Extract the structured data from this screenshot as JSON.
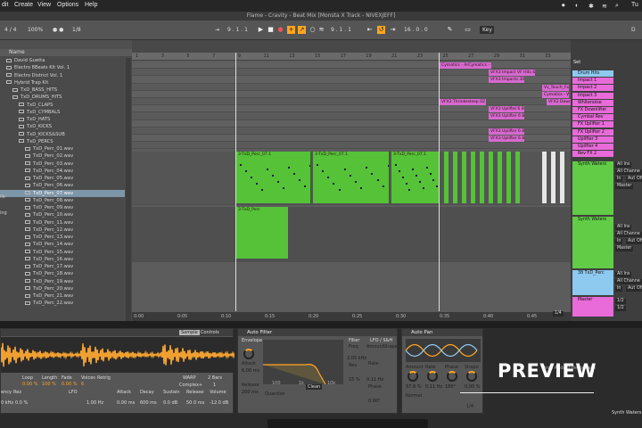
{
  "menubar": {
    "items": [
      "dit",
      "Create",
      "View",
      "Options",
      "Help"
    ],
    "right_text": "Tu"
  },
  "window_title": "Flame - Cravity - Beat Mix  [Monsta X Track - NIVEXJEFF]",
  "transport": {
    "time_sig": "4 / 4",
    "zoom": "100%",
    "quant": "1 Bar",
    "grid": "1/8",
    "position": "9 .  1 .  1",
    "loop_start": "9 .  1 .  1",
    "loop_len": "16 .  0 .  0",
    "link_label": "Link",
    "tap_label": "Tap",
    "tempo": "130.00",
    "right_readout": "D",
    "cpu_label": "Key"
  },
  "browser": {
    "header": "Name",
    "items": [
      {
        "label": "David Guetta",
        "indent": 1
      },
      {
        "label": "Electro 8Beats Kit Vol. 1",
        "indent": 1
      },
      {
        "label": "Electro District Vol. 1",
        "indent": 1
      },
      {
        "label": "Hybrid Trap Kit",
        "indent": 1
      },
      {
        "label": "TxD_BASS_HITS",
        "indent": 2
      },
      {
        "label": "TxD_DRUMS_HITS",
        "indent": 2
      },
      {
        "label": "TxD_CLAPS",
        "indent": 3
      },
      {
        "label": "TxD_CYMBALS",
        "indent": 3
      },
      {
        "label": "TxD_HATS",
        "indent": 3
      },
      {
        "label": "TxD_KICKS",
        "indent": 3
      },
      {
        "label": "TxD_KICKS&SUB",
        "indent": 3
      },
      {
        "label": "TxD_PERCS",
        "indent": 3
      },
      {
        "label": "TxD_Perc_01.wav",
        "indent": 4
      },
      {
        "label": "TxD_Perc_02.wav",
        "indent": 4
      },
      {
        "label": "TxD_Perc_03.wav",
        "indent": 4
      },
      {
        "label": "TxD_Perc_04.wav",
        "indent": 4
      },
      {
        "label": "TxD_Perc_05.wav",
        "indent": 4
      },
      {
        "label": "TxD_Perc_06.wav",
        "indent": 4
      },
      {
        "label": "TxD_Perc_07.wav",
        "indent": 4,
        "selected": true
      },
      {
        "label": "TxD_Perc_08.wav",
        "indent": 4
      },
      {
        "label": "TxD_Perc_09.wav",
        "indent": 4
      },
      {
        "label": "TxD_Perc_10.wav",
        "indent": 4
      },
      {
        "label": "TxD_Perc_11.wav",
        "indent": 4
      },
      {
        "label": "TxD_Perc_12.wav",
        "indent": 4
      },
      {
        "label": "TxD_Perc_13.wav",
        "indent": 4
      },
      {
        "label": "TxD_Perc_14.wav",
        "indent": 4
      },
      {
        "label": "TxD_Perc_15.wav",
        "indent": 4
      },
      {
        "label": "TxD_Perc_16.wav",
        "indent": 4
      },
      {
        "label": "TxD_Perc_17.wav",
        "indent": 4
      },
      {
        "label": "TxD_Perc_18.wav",
        "indent": 4
      },
      {
        "label": "TxD_Perc_19.wav",
        "indent": 4
      },
      {
        "label": "TxD_Perc_20.wav",
        "indent": 4
      },
      {
        "label": "TxD_Perc_21.wav",
        "indent": 4
      },
      {
        "label": "TxD_Perc_22.wav",
        "indent": 4
      }
    ],
    "left_edge_labels": [
      "ile",
      "ing"
    ]
  },
  "arrangement": {
    "ruler": [
      "1",
      "3",
      "5",
      "7",
      "9",
      "11",
      "13",
      "15",
      "17",
      "19",
      "21",
      "23",
      "25",
      "27",
      "29",
      "31",
      "33"
    ],
    "timeline": [
      "0:00",
      "0:05",
      "0:10",
      "0:15",
      "0:20",
      "0:25",
      "0:30",
      "0:35",
      "0:40",
      "0:45"
    ],
    "sfx_clips": [
      {
        "label": "Cymatics - ArCymatics - Impacts 3",
        "row": 0
      },
      {
        "label": "VFX3 Impacts 34",
        "row": 1
      },
      {
        "label": "VFX3 Impacts 30",
        "row": 2
      },
      {
        "label": "VF Hits & Explosi",
        "row": 1
      },
      {
        "label": "Vs_Touch_Fx_13",
        "row": 3
      },
      {
        "label": "Cymatics - Wh",
        "row": 4
      },
      {
        "label": "VFX2 Thrinkesleep 02",
        "row": 5
      },
      {
        "label": "VFX2 Downswe",
        "row": 5
      },
      {
        "label": "VFX3 Upliftei 6 Bars 0",
        "row": 6
      },
      {
        "label": "VFX3 Uplifter 6 Bars 0",
        "row": 7
      },
      {
        "label": "VFX3 Uplifter 6 Bars 0",
        "row": 9
      },
      {
        "label": "VFX3 Uplifter 6 Bars 0",
        "row": 10
      }
    ],
    "perc_clip_label": "3-TxD_Perc_07.1",
    "perc_clip_label2": "3-TxD_Perc_07.1",
    "perc_clip_label3": "3-TxD_Perc_07.1",
    "perc_clip_label4": "3-TxD_Perc_07.1",
    "synth_clip_label": "3-TxD_Perc"
  },
  "mixer": {
    "set_label": "Set",
    "tracks": [
      {
        "label": "Drum Hits",
        "color": "blue"
      },
      {
        "label": "Impact 1",
        "color": "pink"
      },
      {
        "label": "Impact 2",
        "color": "pink"
      },
      {
        "label": "Impact 3",
        "color": "pink"
      },
      {
        "label": "Whitenoise",
        "color": "pink"
      },
      {
        "label": "FX Downlifter",
        "color": "pink"
      },
      {
        "label": "Cymbal Rev",
        "color": "pink"
      },
      {
        "label": "FX Uplifter 1",
        "color": "pink"
      },
      {
        "label": "FX Uplifter 2",
        "color": "pink"
      },
      {
        "label": "Uplifter 3",
        "color": "pink"
      },
      {
        "label": "Uplifter 4",
        "color": "pink"
      },
      {
        "label": "Rev FX 2",
        "color": "pink"
      }
    ],
    "synth_label": "Synth Waters",
    "synth_label2": "Synth Waters",
    "perc_track_label": "38 TxD_Perc",
    "master_label": "Master",
    "all_ins": "All Ins",
    "all_channels": "All Channe",
    "in_label": "In",
    "auto_label": "Auto",
    "off_label": "Off",
    "master_route": "Master",
    "ratio1": "1/2",
    "ratio2": "1/2",
    "zoom_label": "1/4"
  },
  "devices": {
    "simpler": {
      "tabs": [
        "Sample",
        "Controls"
      ],
      "params": [
        "Loop",
        "Length",
        "Fade",
        "Voices",
        "Retrig"
      ],
      "param_vals": [
        "0.00 %",
        "100 %",
        "0.00 %",
        "6",
        ""
      ],
      "lower": [
        "Attack",
        "Decay",
        "Sustain",
        "Release",
        "Volume"
      ],
      "lower_vals": [
        "0.00 ms",
        "600 ms",
        "0.0 dB",
        "50.0 ms",
        "-12.0 dB"
      ],
      "left_labels": [
        "ency",
        "Rez"
      ],
      "left_vals": [
        "0 kHz",
        "0.0 %"
      ],
      "lfo_label": "LFO",
      "lfo_rate": "1.00 Hz",
      "mode": "Complex+",
      "warp": "WARP",
      "bars": "2 Bars",
      "transpose": "1"
    },
    "autofilter": {
      "title": "Auto Filter",
      "envelope": "Envelope",
      "attack_label": "Attack",
      "attack_val": "6.00 ms",
      "release_label": "Release",
      "release_val": "200 ms",
      "filter_label": "Filter",
      "freq_label": "Freq",
      "freq_val": "2.05 kHz",
      "res_label": "Res",
      "res_val": "15 %",
      "lfo_label": "LFO / S&H",
      "amount_label": "Amount",
      "shape_label": "Shape",
      "rate_label": "Rate",
      "rate_val": "0.11 Hz",
      "phase_label": "Phase",
      "phase_val": "0.00°",
      "quantize": "Quantize",
      "mode": "Clean",
      "graph_ticks": [
        "100",
        "1k",
        "10k"
      ]
    },
    "autopan": {
      "title": "Auto Pan",
      "labels": [
        "Amount",
        "Rate",
        "Phase",
        "Shape"
      ],
      "vals": [
        "57.8 %",
        "0.11 Hz",
        "180°",
        "0.00 %"
      ],
      "normal": "Normal",
      "ratio": "1/4"
    },
    "drop_hint": "Drop Audio Effects Here",
    "bottom_track": "Synth Waters"
  },
  "overlay": {
    "preview_text": "PREVIEW"
  },
  "colors": {
    "clip_green": "#55c238",
    "clip_pink": "#d66ad0",
    "track_blue": "#8ec9f0",
    "accent_orange": "#ffa521",
    "selection_blue": "#7d96a8"
  }
}
